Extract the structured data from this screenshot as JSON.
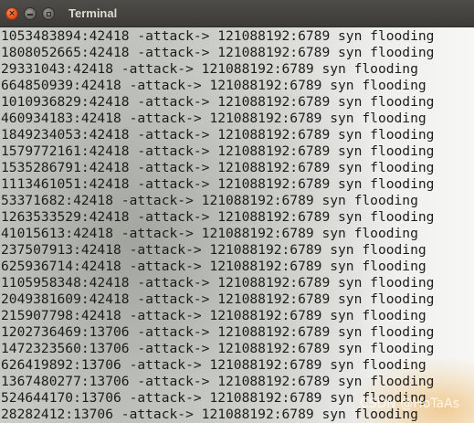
{
  "window": {
    "title": "Terminal",
    "close_glyph": "×"
  },
  "terminal": {
    "lines": [
      "1053483894:42418 -attack-> 121088192:6789 syn flooding",
      "1808052665:42418 -attack-> 121088192:6789 syn flooding",
      "29331043:42418 -attack-> 121088192:6789 syn flooding",
      "664850939:42418 -attack-> 121088192:6789 syn flooding",
      "1010936829:42418 -attack-> 121088192:6789 syn flooding",
      "460934183:42418 -attack-> 121088192:6789 syn flooding",
      "1849234053:42418 -attack-> 121088192:6789 syn flooding",
      "1579772161:42418 -attack-> 121088192:6789 syn flooding",
      "1535286791:42418 -attack-> 121088192:6789 syn flooding",
      "1113461051:42418 -attack-> 121088192:6789 syn flooding",
      "53371682:42418 -attack-> 121088192:6789 syn flooding",
      "1263533529:42418 -attack-> 121088192:6789 syn flooding",
      "41015613:42418 -attack-> 121088192:6789 syn flooding",
      "237507913:42418 -attack-> 121088192:6789 syn flooding",
      "625936714:42418 -attack-> 121088192:6789 syn flooding",
      "1105958348:42418 -attack-> 121088192:6789 syn flooding",
      "2049381609:42418 -attack-> 121088192:6789 syn flooding",
      "215907798:42418 -attack-> 121088192:6789 syn flooding",
      "1202736469:13706 -attack-> 121088192:6789 syn flooding",
      "1472323560:13706 -attack-> 121088192:6789 syn flooding",
      "626419892:13706 -attack-> 121088192:6789 syn flooding",
      "1367480277:13706 -attack-> 121088192:6789 syn flooding",
      "524644170:13706 -attack-> 121088192:6789 syn flooding",
      "28282412:13706 -attack-> 121088192:6789 syn flooding"
    ]
  },
  "watermark": {
    "text": "CSDN @HoTaAs"
  },
  "icons": {
    "close": "close-icon",
    "minimize": "minimize-icon",
    "maximize": "maximize-icon"
  }
}
